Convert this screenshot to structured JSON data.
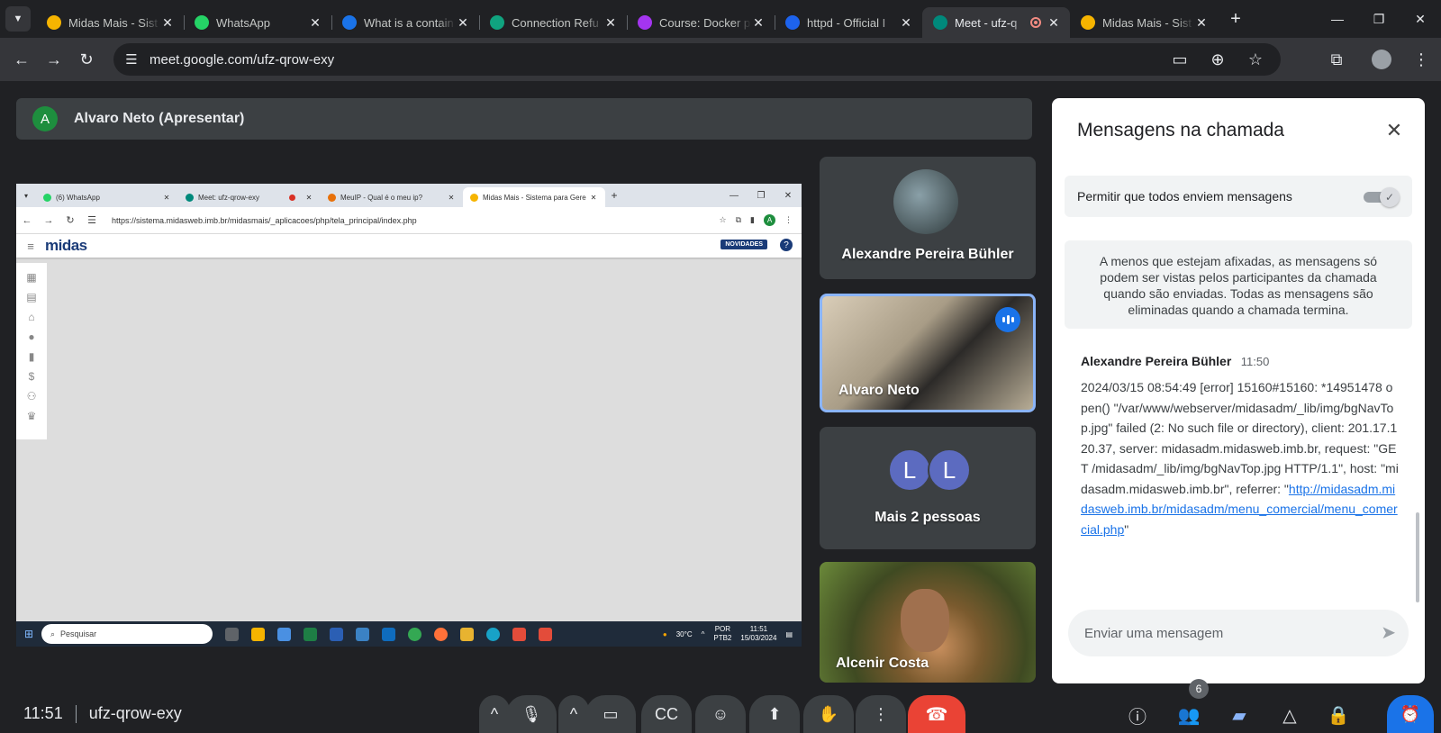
{
  "browser": {
    "tabs": [
      {
        "title": "Midas Mais - Sist",
        "favicon_color": "#f6b400"
      },
      {
        "title": "WhatsApp",
        "favicon_color": "#25d366"
      },
      {
        "title": "What is a contain",
        "favicon_color": "#1a73e8"
      },
      {
        "title": "Connection Refu",
        "favicon_color": "#10a37f"
      },
      {
        "title": "Course: Docker p",
        "favicon_color": "#a435f0"
      },
      {
        "title": "httpd - Official I",
        "favicon_color": "#1d63ed"
      },
      {
        "title": "Meet - ufz-q",
        "favicon_color": "#00897b",
        "active": true,
        "recording": true
      },
      {
        "title": "Midas Mais - Sist",
        "favicon_color": "#f6b400"
      }
    ],
    "url": "meet.google.com/ufz-qrow-exy"
  },
  "presenter": {
    "initial": "A",
    "label": "Alvaro Neto (Apresentar)"
  },
  "shared_screen": {
    "tabs": [
      {
        "title": "(6) WhatsApp",
        "color": "#25d366"
      },
      {
        "title": "Meet: ufz-qrow-exy",
        "color": "#00897b"
      },
      {
        "title": "MeuIP - Qual é o meu ip?",
        "color": "#e8710a"
      },
      {
        "title": "Midas Mais - Sistema para Gere",
        "color": "#f6b400",
        "active": true
      }
    ],
    "url": "https://sistema.midasweb.imb.br/midasmais/_aplicacoes/php/tela_principal/index.php",
    "avatar_initial": "A",
    "logo_text": "midas",
    "novidades": "NOVIDADES",
    "help": "?",
    "taskbar": {
      "search": "Pesquisar",
      "weather": "30°C",
      "lang": "POR",
      "lang2": "PTB2",
      "time": "11:51",
      "date": "15/03/2024"
    }
  },
  "participants": [
    {
      "name": "Alexandre Pereira Bühler"
    },
    {
      "name": "Alvaro Neto",
      "speaking": true
    },
    {
      "name": "Mais 2 pessoas",
      "initials": [
        "L",
        "L"
      ]
    },
    {
      "name": "Alcenir Costa"
    }
  ],
  "chat": {
    "title": "Mensagens na chamada",
    "permission_label": "Permitir que todos enviem mensagens",
    "info": "A menos que estejam afixadas, as mensagens só podem ser vistas pelos participantes da chamada quando são enviadas. Todas as mensagens são eliminadas quando a chamada termina.",
    "message": {
      "sender": "Alexandre Pereira Bühler",
      "time": "11:50",
      "text": "2024/03/15 08:54:49 [error] 15160#15160: *14951478 open() \"/var/www/webserver/midasadm/_lib/img/bgNavTop.jpg\" failed (2: No such file or directory), client: 201.17.120.37, server: midasadm.midasweb.imb.br, request: \"GET /midasadm/_lib/img/bgNavTop.jpg HTTP/1.1\", host: \"midasadm.midasweb.imb.br\", referrer: \"",
      "link": "http://midasadm.midasweb.imb.br/midasadm/menu_comercial/menu_comercial.php",
      "trailing": "\""
    },
    "input_placeholder": "Enviar uma mensagem"
  },
  "bottom_bar": {
    "time": "11:51",
    "meeting_code": "ufz-qrow-exy",
    "people_count": "6"
  },
  "colors": {
    "accent": "#1a73e8",
    "hangup": "#ea4335",
    "speaking_border": "#8ab4f8"
  }
}
